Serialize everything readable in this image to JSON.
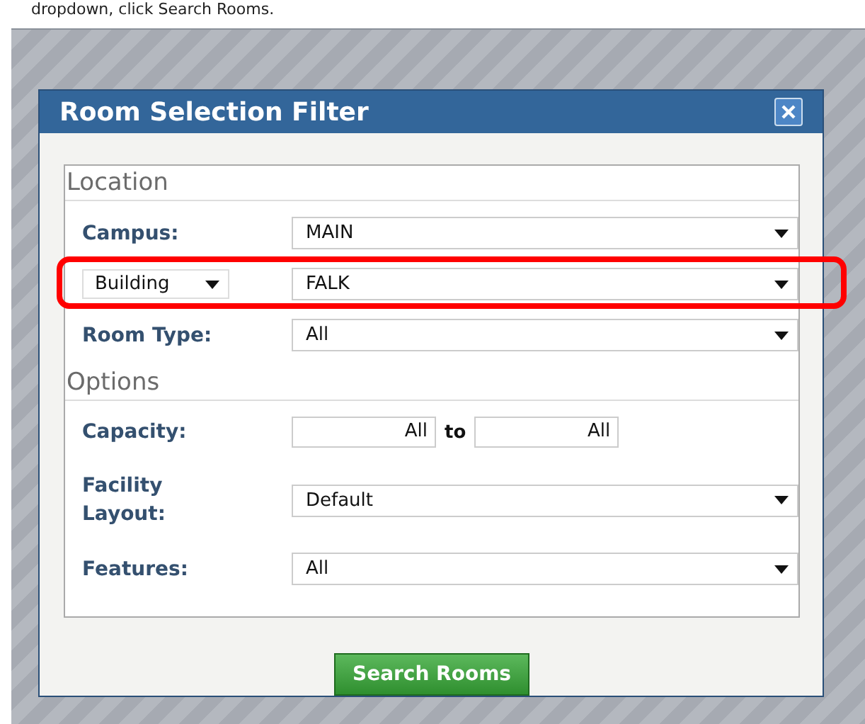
{
  "instruction": "dropdown, click Search Rooms.",
  "dialog": {
    "title": "Room Selection Filter",
    "sections": [
      {
        "legend": "Location",
        "rows": [
          {
            "kind": "select",
            "label": {
              "kind": "text",
              "text": "Campus:"
            },
            "value": "MAIN",
            "highlighted": false
          },
          {
            "kind": "select",
            "label": {
              "kind": "dropdown",
              "text": "Building"
            },
            "value": "FALK",
            "highlighted": true
          },
          {
            "kind": "select",
            "label": {
              "kind": "text",
              "text": "Room Type:"
            },
            "value": "All",
            "highlighted": false
          }
        ]
      },
      {
        "legend": "Options",
        "rows": [
          {
            "kind": "range",
            "label": {
              "kind": "text",
              "text": "Capacity:"
            },
            "from": "All",
            "joiner": "to",
            "to": "All",
            "highlighted": false
          },
          {
            "kind": "select",
            "label": {
              "kind": "text",
              "text": "Facility Layout:"
            },
            "value": "Default",
            "highlighted": false
          },
          {
            "kind": "select",
            "label": {
              "kind": "text",
              "text": "Features:"
            },
            "value": "All",
            "highlighted": false
          }
        ]
      }
    ],
    "button": "Search Rooms"
  }
}
